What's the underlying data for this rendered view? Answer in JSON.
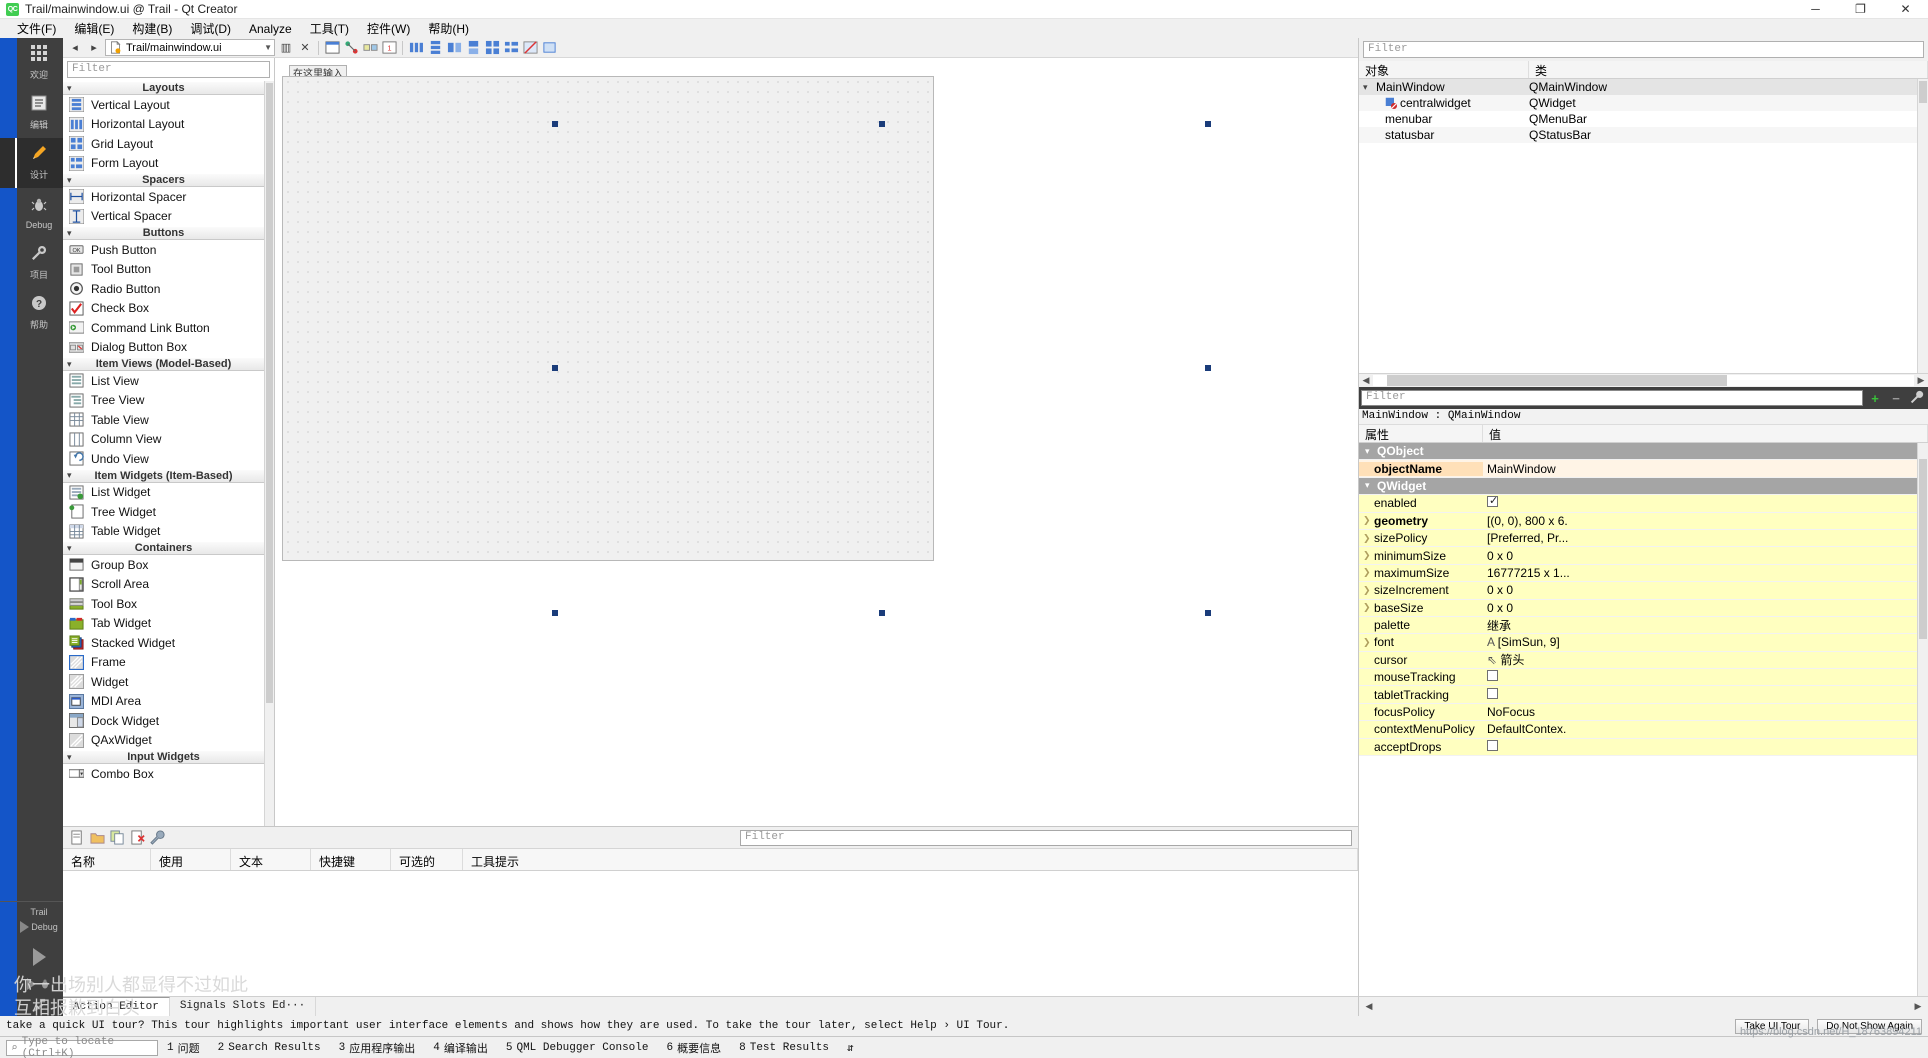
{
  "window": {
    "title": "Trail/mainwindow.ui @ Trail - Qt Creator",
    "logo": "QC",
    "minimize": "─",
    "maximize": "❐",
    "close": "✕"
  },
  "menubar": {
    "items": [
      {
        "label": "文件(F)",
        "name": "menu-file"
      },
      {
        "label": "编辑(E)",
        "name": "menu-edit"
      },
      {
        "label": "构建(B)",
        "name": "menu-build"
      },
      {
        "label": "调试(D)",
        "name": "menu-debug"
      },
      {
        "label": "Analyze",
        "name": "menu-analyze"
      },
      {
        "label": "工具(T)",
        "name": "menu-tools"
      },
      {
        "label": "控件(W)",
        "name": "menu-window"
      },
      {
        "label": "帮助(H)",
        "name": "menu-help"
      }
    ]
  },
  "modebar": {
    "items": [
      {
        "label": "欢迎",
        "icon": "grid-icon",
        "glyph": "▒",
        "active": false
      },
      {
        "label": "编辑",
        "icon": "document-icon",
        "glyph": "☰",
        "active": false
      },
      {
        "label": "设计",
        "icon": "pencil-icon",
        "glyph": "✎",
        "active": true
      },
      {
        "label": "Debug",
        "icon": "bug-icon",
        "glyph": "☣",
        "active": false
      },
      {
        "label": "项目",
        "icon": "wrench-icon",
        "glyph": "⚒",
        "active": false
      },
      {
        "label": "帮助",
        "icon": "question-icon",
        "glyph": "❓",
        "active": false
      }
    ],
    "kit": {
      "project": "Trail",
      "config": "Debug"
    }
  },
  "editor_toolbar": {
    "back": "◂",
    "forward": "▸",
    "file_path": "Trail/mainwindow.ui",
    "split": "▥",
    "close": "✕",
    "tools": [
      {
        "name": "edit-widgets-icon",
        "glyph": "▤"
      },
      {
        "name": "edit-signals-slots-icon",
        "glyph": "⇋"
      },
      {
        "name": "edit-buddies-icon",
        "glyph": "⎇"
      },
      {
        "name": "edit-tab-order-icon",
        "glyph": "↹"
      },
      {
        "name": "layout-horizontal-icon",
        "glyph": "‖"
      },
      {
        "name": "layout-vertical-icon",
        "glyph": "≡"
      },
      {
        "name": "layout-splitter-h-icon",
        "glyph": "⊢"
      },
      {
        "name": "layout-splitter-v-icon",
        "glyph": "⊣"
      },
      {
        "name": "layout-grid-icon",
        "glyph": "⊞"
      },
      {
        "name": "layout-form-icon",
        "glyph": "▦"
      },
      {
        "name": "break-layout-icon",
        "glyph": "⌧"
      },
      {
        "name": "adjust-size-icon",
        "glyph": "⬚"
      }
    ]
  },
  "widget_box": {
    "filter_placeholder": "Filter",
    "groups": [
      {
        "title": "Layouts",
        "items": [
          {
            "label": "Vertical Layout",
            "icon": "vertical-layout-icon"
          },
          {
            "label": "Horizontal Layout",
            "icon": "horizontal-layout-icon"
          },
          {
            "label": "Grid Layout",
            "icon": "grid-layout-icon"
          },
          {
            "label": "Form Layout",
            "icon": "form-layout-icon"
          }
        ]
      },
      {
        "title": "Spacers",
        "items": [
          {
            "label": "Horizontal Spacer",
            "icon": "horizontal-spacer-icon"
          },
          {
            "label": "Vertical Spacer",
            "icon": "vertical-spacer-icon"
          }
        ]
      },
      {
        "title": "Buttons",
        "items": [
          {
            "label": "Push Button",
            "icon": "push-button-icon"
          },
          {
            "label": "Tool Button",
            "icon": "tool-button-icon"
          },
          {
            "label": "Radio Button",
            "icon": "radio-button-icon"
          },
          {
            "label": "Check Box",
            "icon": "check-box-icon"
          },
          {
            "label": "Command Link Button",
            "icon": "command-link-button-icon"
          },
          {
            "label": "Dialog Button Box",
            "icon": "dialog-button-box-icon"
          }
        ]
      },
      {
        "title": "Item Views (Model-Based)",
        "items": [
          {
            "label": "List View",
            "icon": "list-view-icon"
          },
          {
            "label": "Tree View",
            "icon": "tree-view-icon"
          },
          {
            "label": "Table View",
            "icon": "table-view-icon"
          },
          {
            "label": "Column View",
            "icon": "column-view-icon"
          },
          {
            "label": "Undo View",
            "icon": "undo-view-icon"
          }
        ]
      },
      {
        "title": "Item Widgets (Item-Based)",
        "items": [
          {
            "label": "List Widget",
            "icon": "list-widget-icon"
          },
          {
            "label": "Tree Widget",
            "icon": "tree-widget-icon"
          },
          {
            "label": "Table Widget",
            "icon": "table-widget-icon"
          }
        ]
      },
      {
        "title": "Containers",
        "items": [
          {
            "label": "Group Box",
            "icon": "group-box-icon"
          },
          {
            "label": "Scroll Area",
            "icon": "scroll-area-icon"
          },
          {
            "label": "Tool Box",
            "icon": "tool-box-icon"
          },
          {
            "label": "Tab Widget",
            "icon": "tab-widget-icon"
          },
          {
            "label": "Stacked Widget",
            "icon": "stacked-widget-icon"
          },
          {
            "label": "Frame",
            "icon": "frame-icon"
          },
          {
            "label": "Widget",
            "icon": "widget-icon"
          },
          {
            "label": "MDI Area",
            "icon": "mdi-area-icon"
          },
          {
            "label": "Dock Widget",
            "icon": "dock-widget-icon"
          },
          {
            "label": "QAxWidget",
            "icon": "qaxwidget-icon"
          }
        ]
      },
      {
        "title": "Input Widgets",
        "items": [
          {
            "label": "Combo Box",
            "icon": "combo-box-icon"
          }
        ]
      }
    ]
  },
  "form_editor": {
    "tab_label": "在这里输入"
  },
  "action_editor": {
    "title": "Action Editor",
    "filter_placeholder": "Filter",
    "columns": [
      "名称",
      "使用",
      "文本",
      "快捷键",
      "可选的",
      "工具提示"
    ],
    "rows": [],
    "tabs": [
      {
        "label": "Action Editor",
        "active": true
      },
      {
        "label": "Signals Slots Ed···",
        "active": false
      }
    ],
    "toolbar": [
      {
        "name": "new-action-icon",
        "glyph": "⬜"
      },
      {
        "name": "open-resource-icon",
        "glyph": "὜0"
      },
      {
        "name": "copy-icon",
        "glyph": "⧉"
      },
      {
        "name": "delete-icon",
        "glyph": "✖"
      },
      {
        "name": "settings-icon",
        "glyph": "⚒"
      }
    ]
  },
  "object_inspector": {
    "filter_placeholder": "Filter",
    "columns": [
      "对象",
      "类"
    ],
    "rows": [
      {
        "object": "MainWindow",
        "class": "QMainWindow",
        "indent": 0,
        "expanded": true,
        "selected": true,
        "icon": "mainwindow-icon"
      },
      {
        "object": "centralwidget",
        "class": "QWidget",
        "indent": 1,
        "expanded": false,
        "selected": false,
        "icon": "widget-icon"
      },
      {
        "object": "menubar",
        "class": "QMenuBar",
        "indent": 1,
        "expanded": false,
        "selected": false,
        "icon": ""
      },
      {
        "object": "statusbar",
        "class": "QStatusBar",
        "indent": 1,
        "expanded": false,
        "selected": false,
        "icon": ""
      }
    ]
  },
  "property_editor": {
    "filter_placeholder": "Filter",
    "add_label": "+",
    "remove_label": "−",
    "config_label": "⚒",
    "object_line": "MainWindow : QMainWindow",
    "columns": [
      "属性",
      "值"
    ],
    "rows": [
      {
        "kind": "group",
        "key": "QObject",
        "value": ""
      },
      {
        "kind": "orange",
        "key": "objectName",
        "value": "MainWindow",
        "expand": false,
        "bold": true
      },
      {
        "kind": "group",
        "key": "QWidget",
        "value": ""
      },
      {
        "kind": "yellow",
        "key": "enabled",
        "value": "",
        "expand": false,
        "checkbox": true,
        "checked": true
      },
      {
        "kind": "yellow",
        "key": "geometry",
        "value": "[(0, 0), 800 x 6.",
        "expand": true,
        "bold": true
      },
      {
        "kind": "yellow",
        "key": "sizePolicy",
        "value": "[Preferred, Pr...",
        "expand": true
      },
      {
        "kind": "yellow",
        "key": "minimumSize",
        "value": "0 x 0",
        "expand": true
      },
      {
        "kind": "yellow",
        "key": "maximumSize",
        "value": "16777215 x 1...",
        "expand": true
      },
      {
        "kind": "yellow",
        "key": "sizeIncrement",
        "value": "0 x 0",
        "expand": true
      },
      {
        "kind": "yellow",
        "key": "baseSize",
        "value": "0 x 0",
        "expand": true
      },
      {
        "kind": "yellow",
        "key": "palette",
        "value": "继承",
        "expand": false
      },
      {
        "kind": "yellow",
        "key": "font",
        "value": "[SimSun, 9]",
        "expand": true,
        "prefix": "A"
      },
      {
        "kind": "yellow",
        "key": "cursor",
        "value": "箭头",
        "expand": false,
        "prefix": "⇖"
      },
      {
        "kind": "yellow",
        "key": "mouseTracking",
        "value": "",
        "expand": false,
        "checkbox": true,
        "checked": false
      },
      {
        "kind": "yellow",
        "key": "tabletTracking",
        "value": "",
        "expand": false,
        "checkbox": true,
        "checked": false
      },
      {
        "kind": "yellow",
        "key": "focusPolicy",
        "value": "NoFocus",
        "expand": false
      },
      {
        "kind": "yellow",
        "key": "contextMenuPolicy",
        "value": "DefaultContex.",
        "expand": false
      },
      {
        "kind": "yellow",
        "key": "acceptDrops",
        "value": "",
        "expand": false,
        "checkbox": true,
        "checked": false
      }
    ]
  },
  "tour_bar": {
    "message": "take a quick UI tour? This tour highlights important user interface elements and shows how they are used.  To take the tour later, select Help › UI Tour.",
    "take_tour": "Take UI Tour",
    "do_not_show": "Do Not Show Again"
  },
  "output_bar": {
    "items": [
      {
        "num": "1",
        "label": "问题"
      },
      {
        "num": "2",
        "label": "Search Results"
      },
      {
        "num": "3",
        "label": "应用程序输出"
      },
      {
        "num": "4",
        "label": "编译输出"
      },
      {
        "num": "5",
        "label": "QML Debugger Console"
      },
      {
        "num": "6",
        "label": "概要信息"
      },
      {
        "num": "8",
        "label": "Test Results"
      }
    ],
    "locate_placeholder": "Type to locate (Ctrl+K)",
    "search_icon": "⌕",
    "more": "⇵"
  },
  "watermark": {
    "line1": "你一出场别人都显得不过如此",
    "line2": "互相报歉到白头",
    "url": "https://blog.csdn.net/H_18763894211"
  },
  "colors": {
    "accent_blue": "#1455c8",
    "mode_active_orange": "#f5a623",
    "panel_bg": "#f0f0f0",
    "group_row": "#a5a5a5",
    "prop_yellow": "#ffffc0",
    "prop_orange": "#ffe0b8"
  }
}
